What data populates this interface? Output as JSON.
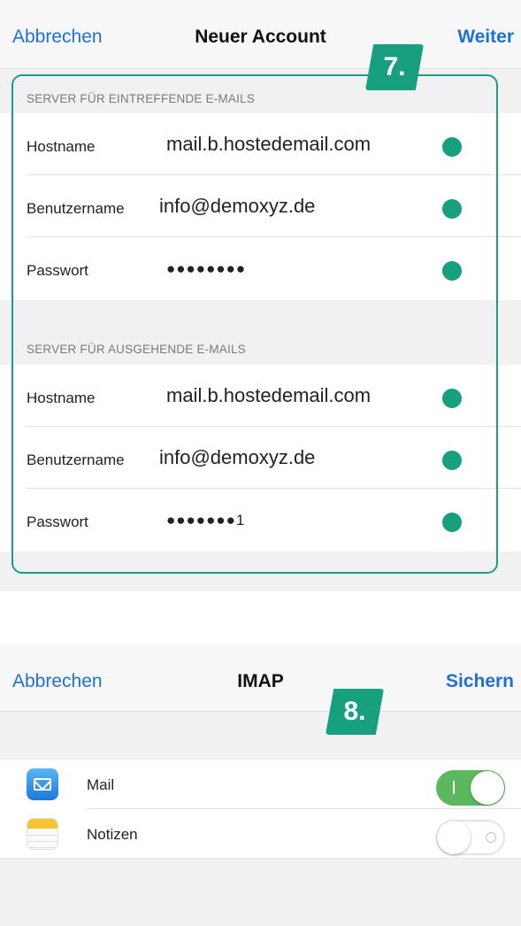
{
  "screen1": {
    "navbar": {
      "cancel": "Abbrechen",
      "title": "Neuer Account",
      "next": "Weiter"
    },
    "step_badge": "7.",
    "incoming": {
      "header": "SERVER FÜR EINTREFFENDE E-MAILS",
      "rows": [
        {
          "label": "Hostname",
          "value": "mail.b.hostedemail.com"
        },
        {
          "label": "Benutzername",
          "value": "info@demoxyz.de"
        },
        {
          "label": "Passwort",
          "value": "●●●●●●●●"
        }
      ]
    },
    "outgoing": {
      "header": "SERVER FÜR AUSGEHENDE E-MAILS",
      "rows": [
        {
          "label": "Hostname",
          "value": "mail.b.hostedemail.com"
        },
        {
          "label": "Benutzername",
          "value": "info@demoxyz.de"
        },
        {
          "label": "Passwort",
          "value": "●●●●●●●1"
        }
      ]
    },
    "accent_color": "#17a07e"
  },
  "screen2": {
    "navbar": {
      "cancel": "Abbrechen",
      "title": "IMAP",
      "save": "Sichern"
    },
    "step_badge": "8.",
    "apps": [
      {
        "label": "Mail",
        "icon": "mail-icon",
        "enabled": true
      },
      {
        "label": "Notizen",
        "icon": "notes-icon",
        "enabled": false
      }
    ],
    "toggle_on_color": "#5bb85d"
  }
}
